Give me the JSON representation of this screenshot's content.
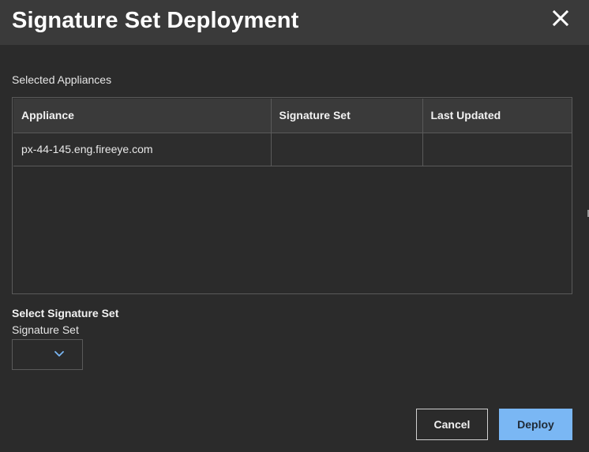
{
  "dialog": {
    "title": "Signature Set Deployment",
    "close_icon": "close-icon"
  },
  "appliances": {
    "section_label": "Selected Appliances",
    "columns": [
      "Appliance",
      "Signature Set",
      "Last Updated"
    ],
    "rows": [
      [
        "px-44-145.eng.fireeye.com",
        "",
        ""
      ]
    ]
  },
  "signature_select": {
    "heading": "Select Signature Set",
    "label": "Signature Set",
    "selected_value": "",
    "chevron_icon": "chevron-down-icon"
  },
  "actions": {
    "cancel_label": "Cancel",
    "deploy_label": "Deploy"
  },
  "colors": {
    "background": "#2b2b2b",
    "title_bar": "#3a3a3a",
    "border": "#5a5a5a",
    "accent": "#7ab7f4",
    "chevron": "#7ab7f4",
    "text": "#ffffff"
  }
}
